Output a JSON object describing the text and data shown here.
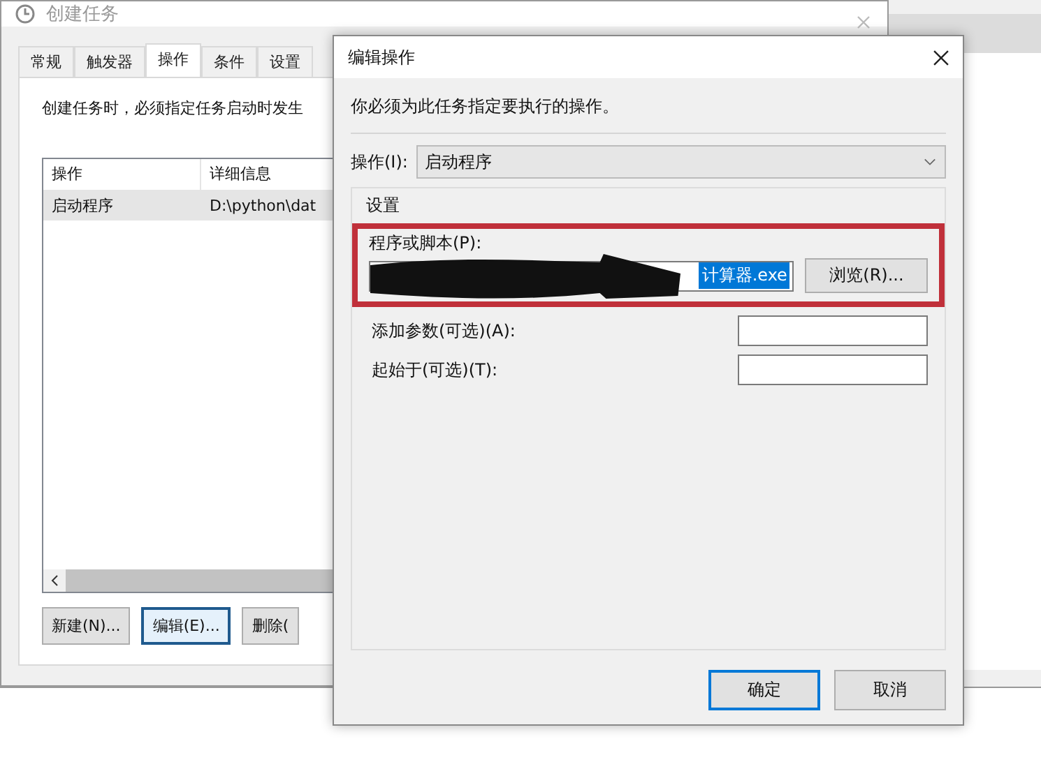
{
  "background_window": {
    "title": "创建任务",
    "tabs": [
      {
        "label": "常规",
        "selected": false
      },
      {
        "label": "触发器",
        "selected": false
      },
      {
        "label": "操作",
        "selected": true
      },
      {
        "label": "条件",
        "selected": false
      },
      {
        "label": "设置",
        "selected": false
      }
    ],
    "description": "创建任务时，必须指定任务启动时发生",
    "table": {
      "columns": [
        "操作",
        "详细信息"
      ],
      "rows": [
        {
          "cells": [
            "启动程序",
            "D:\\python\\dat"
          ],
          "selected": true
        }
      ]
    },
    "buttons": [
      {
        "label": "新建(N)...",
        "focused": false
      },
      {
        "label": "编辑(E)...",
        "focused": true
      },
      {
        "label": "删除(",
        "focused": false
      }
    ]
  },
  "dialog": {
    "title": "编辑操作",
    "instruction": "你必须为此任务指定要执行的操作。",
    "action_label": "操作(I):",
    "action_value": "启动程序",
    "group_label": "设置",
    "script": {
      "label": "程序或脚本(P):",
      "value": "计算器.exe",
      "value_selected": true,
      "redacted": true,
      "highlighted": true
    },
    "browse_button": "浏览(R)...",
    "fields": [
      {
        "label": "添加参数(可选)(A):"
      },
      {
        "label": "起始于(可选)(T):"
      }
    ],
    "buttons": [
      {
        "label": "确定",
        "default": true
      },
      {
        "label": "取消",
        "default": false
      }
    ]
  }
}
